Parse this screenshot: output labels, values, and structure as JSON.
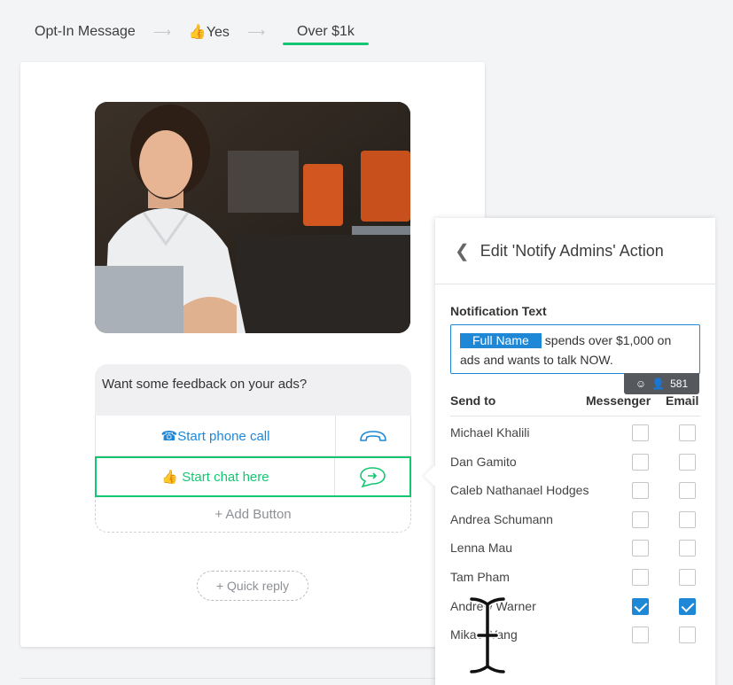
{
  "breadcrumb": [
    "Opt-In Message",
    "👍Yes",
    "Over $1k"
  ],
  "message": {
    "text": "Want some feedback on your ads?",
    "buttons": [
      {
        "label": "☎Start phone call",
        "icon": "phone-icon"
      },
      {
        "label": "👍 Start chat here",
        "icon": "chat-arrow-icon"
      }
    ],
    "add_button": "+ Add Button",
    "quick_reply": "+ Quick reply"
  },
  "panel": {
    "title": "Edit 'Notify Admins' Action",
    "notification_label": "Notification Text",
    "chip": "Full Name",
    "notification_text": "spends over $1,000 on ads and wants to talk NOW.",
    "count": "581",
    "headers": {
      "send_to": "Send to",
      "messenger": "Messenger",
      "email": "Email"
    },
    "recipients": [
      {
        "name": "Michael Khalili",
        "messenger": false,
        "email": false
      },
      {
        "name": "Dan Gamito",
        "messenger": false,
        "email": false
      },
      {
        "name": "Caleb Nathanael Hodges",
        "messenger": false,
        "email": false
      },
      {
        "name": "Andrea Schumann",
        "messenger": false,
        "email": false
      },
      {
        "name": "Lenna Mau",
        "messenger": false,
        "email": false
      },
      {
        "name": "Tam Pham",
        "messenger": false,
        "email": false
      },
      {
        "name": "Andrew Warner",
        "messenger": true,
        "email": true
      },
      {
        "name": "Mikael Yang",
        "messenger": false,
        "email": false
      }
    ]
  },
  "colors": {
    "accent_green": "#14c672",
    "accent_blue": "#1e88d6"
  }
}
